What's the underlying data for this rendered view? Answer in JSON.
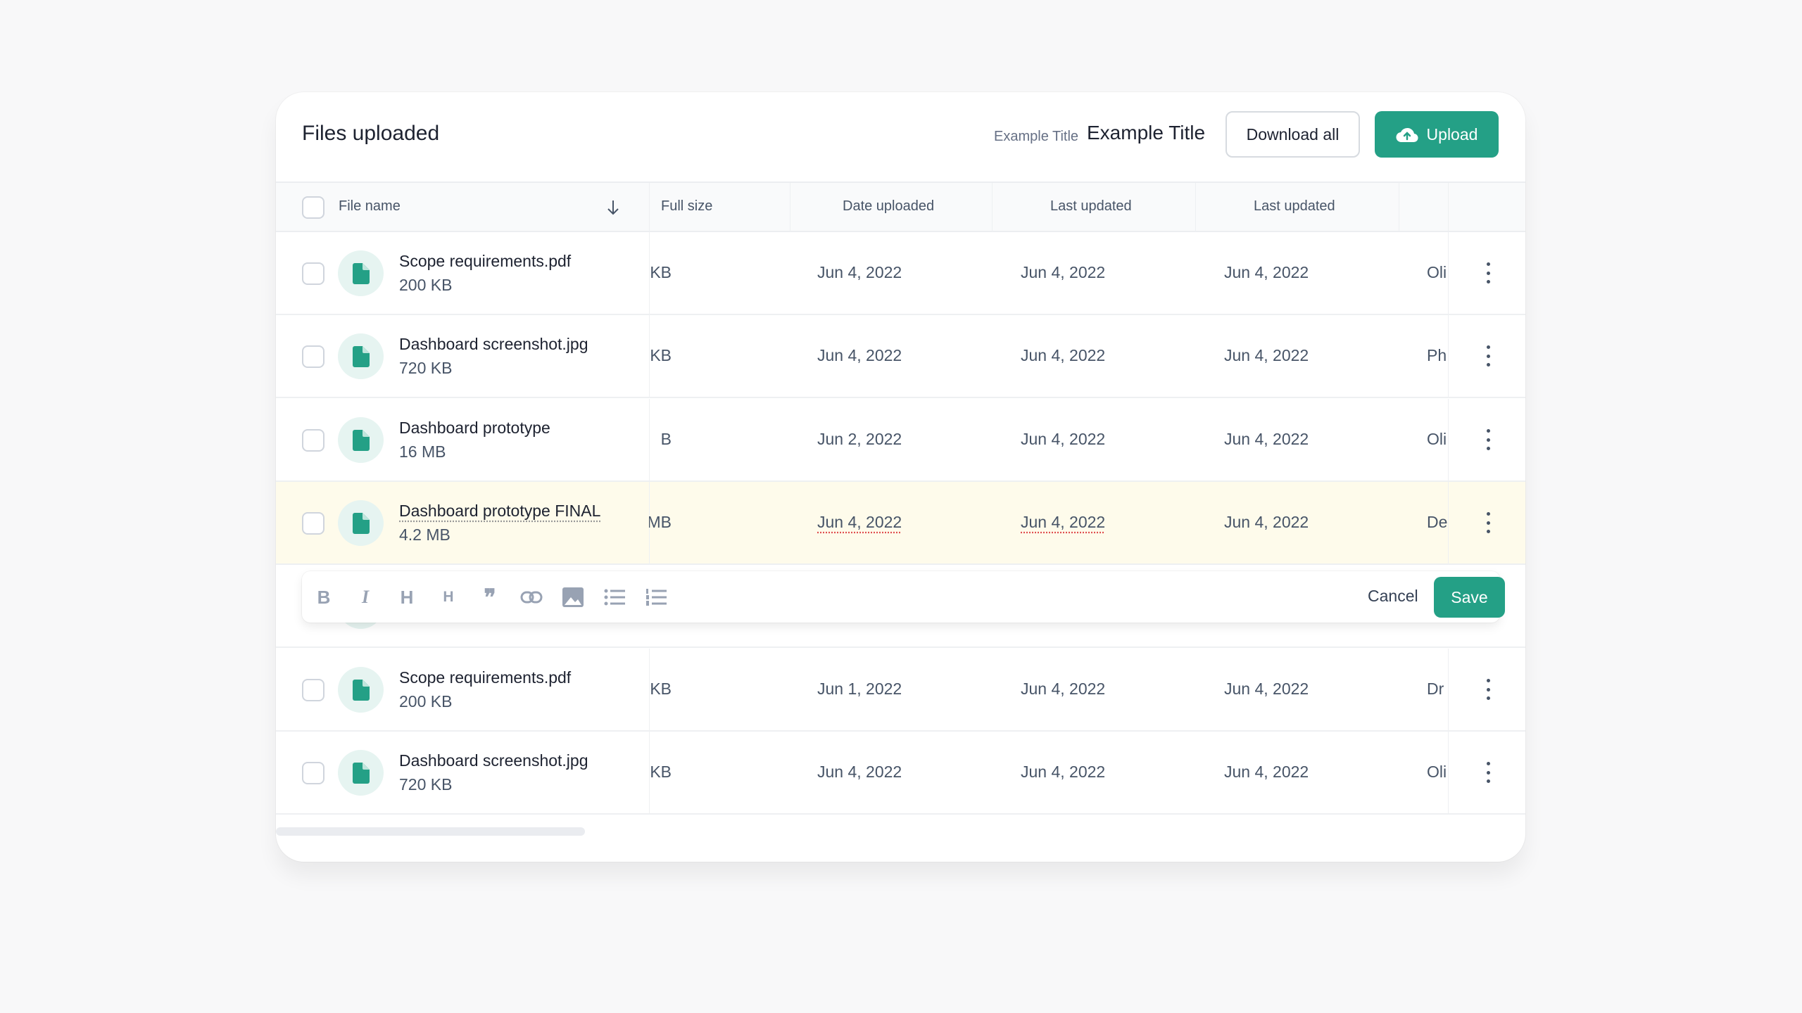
{
  "header": {
    "title": "Files uploaded",
    "example_small": "Example Title",
    "example_big": "Example Title",
    "download_all": "Download all",
    "upload": "Upload"
  },
  "colors": {
    "accent": "#24a086",
    "highlight": "#fefbeb"
  },
  "columns": [
    "File name",
    "Full size",
    "Date uploaded",
    "Last updated",
    "Last updated"
  ],
  "rows": [
    {
      "name": "Scope requirements.pdf",
      "size": "200 KB",
      "full": "KB",
      "uploaded": "Jun 4, 2022",
      "updated1": "Jun 4, 2022",
      "updated2": "Jun 4, 2022",
      "owner": "Oli"
    },
    {
      "name": "Dashboard screenshot.jpg",
      "size": "720 KB",
      "full": "KB",
      "uploaded": "Jun 4, 2022",
      "updated1": "Jun 4, 2022",
      "updated2": "Jun 4, 2022",
      "owner": "Ph"
    },
    {
      "name": "Dashboard prototype",
      "size": "16 MB",
      "full": "B",
      "uploaded": "Jun 2, 2022",
      "updated1": "Jun 4, 2022",
      "updated2": "Jun 4, 2022",
      "owner": "Oli"
    },
    {
      "name": "Dashboard prototype FINAL",
      "size": "4.2 MB",
      "full": "MB",
      "uploaded": "Jun 4, 2022",
      "updated1": "Jun 4, 2022",
      "updated2": "Jun 4, 2022",
      "owner": "De"
    },
    {
      "name": "",
      "size": "",
      "full": "",
      "uploaded": "",
      "updated1": "",
      "updated2": "",
      "owner": ""
    },
    {
      "name": "Scope requirements.pdf",
      "size": "200 KB",
      "full": "KB",
      "uploaded": "Jun 1, 2022",
      "updated1": "Jun 4, 2022",
      "updated2": "Jun 4, 2022",
      "owner": "Dr"
    },
    {
      "name": "Dashboard screenshot.jpg",
      "size": "720 KB",
      "full": "KB",
      "uploaded": "Jun 4, 2022",
      "updated1": "Jun 4, 2022",
      "updated2": "Jun 4, 2022",
      "owner": "Oli"
    }
  ],
  "editor": {
    "tools": [
      "bold",
      "italic",
      "heading-1",
      "heading-2",
      "quote",
      "link",
      "image",
      "bullet-list",
      "numbered-list"
    ],
    "bold": "B",
    "italic": "I",
    "h1": "H",
    "h2": "H",
    "quote": "❞",
    "cancel": "Cancel",
    "save": "Save"
  }
}
